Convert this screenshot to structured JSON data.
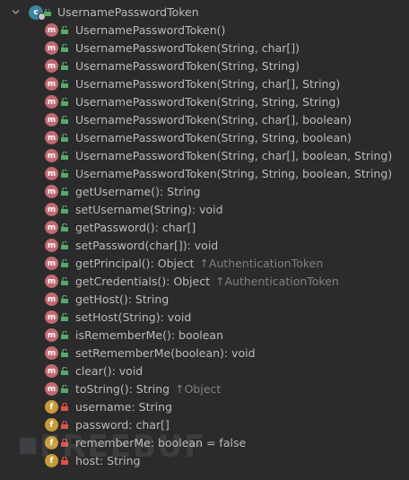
{
  "tree": {
    "root": {
      "label": "UsernamePasswordToken",
      "icon": "class-icon"
    },
    "members": [
      {
        "kind": "m",
        "access": "public",
        "label": "UsernamePasswordToken()",
        "suffix": ""
      },
      {
        "kind": "m",
        "access": "public",
        "label": "UsernamePasswordToken(String, char[])",
        "suffix": ""
      },
      {
        "kind": "m",
        "access": "public",
        "label": "UsernamePasswordToken(String, String)",
        "suffix": ""
      },
      {
        "kind": "m",
        "access": "public",
        "label": "UsernamePasswordToken(String, char[], String)",
        "suffix": ""
      },
      {
        "kind": "m",
        "access": "public",
        "label": "UsernamePasswordToken(String, String, String)",
        "suffix": ""
      },
      {
        "kind": "m",
        "access": "public",
        "label": "UsernamePasswordToken(String, char[], boolean)",
        "suffix": ""
      },
      {
        "kind": "m",
        "access": "public",
        "label": "UsernamePasswordToken(String, String, boolean)",
        "suffix": ""
      },
      {
        "kind": "m",
        "access": "public",
        "label": "UsernamePasswordToken(String, char[], boolean, String)",
        "suffix": ""
      },
      {
        "kind": "m",
        "access": "public",
        "label": "UsernamePasswordToken(String, String, boolean, String)",
        "suffix": ""
      },
      {
        "kind": "m",
        "access": "public",
        "label": "getUsername(): String",
        "suffix": ""
      },
      {
        "kind": "m",
        "access": "public",
        "label": "setUsername(String): void",
        "suffix": ""
      },
      {
        "kind": "m",
        "access": "public",
        "label": "getPassword(): char[]",
        "suffix": ""
      },
      {
        "kind": "m",
        "access": "public",
        "label": "setPassword(char[]): void",
        "suffix": ""
      },
      {
        "kind": "m",
        "access": "public",
        "label": "getPrincipal(): Object",
        "suffix": "↑AuthenticationToken"
      },
      {
        "kind": "m",
        "access": "public",
        "label": "getCredentials(): Object",
        "suffix": "↑AuthenticationToken"
      },
      {
        "kind": "m",
        "access": "public",
        "label": "getHost(): String",
        "suffix": ""
      },
      {
        "kind": "m",
        "access": "public",
        "label": "setHost(String): void",
        "suffix": ""
      },
      {
        "kind": "m",
        "access": "public",
        "label": "isRememberMe(): boolean",
        "suffix": ""
      },
      {
        "kind": "m",
        "access": "public",
        "label": "setRememberMe(boolean): void",
        "suffix": ""
      },
      {
        "kind": "m",
        "access": "public",
        "label": "clear(): void",
        "suffix": ""
      },
      {
        "kind": "m",
        "access": "public",
        "label": "toString(): String",
        "suffix": "↑Object"
      },
      {
        "kind": "f",
        "access": "private",
        "label": "username: String",
        "suffix": ""
      },
      {
        "kind": "f",
        "access": "private",
        "label": "password: char[]",
        "suffix": ""
      },
      {
        "kind": "f",
        "access": "private",
        "label": "rememberMe: boolean = false",
        "suffix": ""
      },
      {
        "kind": "f",
        "access": "private",
        "label": "host: String",
        "suffix": ""
      }
    ]
  },
  "colors": {
    "background": "#2b2b2b",
    "method_icon": "#c16a73",
    "field_icon": "#c89a3a",
    "public_access": "#59a869",
    "private_access": "#d9534f"
  },
  "watermark": {
    "text": "FREEBUF"
  }
}
